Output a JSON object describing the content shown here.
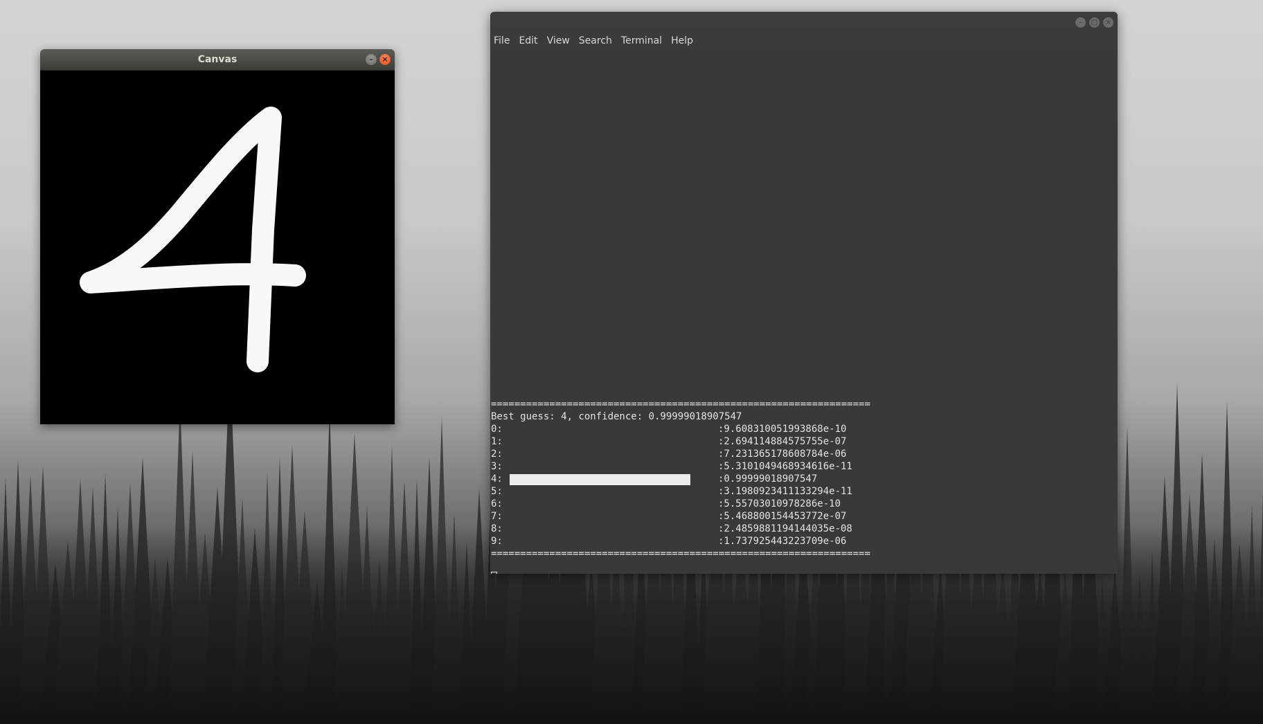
{
  "canvas_window": {
    "title": "Canvas",
    "drawn_digit": "4"
  },
  "terminal_window": {
    "menu": [
      "File",
      "Edit",
      "View",
      "Search",
      "Terminal",
      "Help"
    ],
    "separator": "=================================================================",
    "best_guess_line": "Best guess: 4, confidence: 0.99999018907547",
    "predictions": [
      {
        "digit": "0:",
        "value": ":9.608310051993868e-10",
        "probability": 0.0
      },
      {
        "digit": "1:",
        "value": ":2.694114884575755e-07",
        "probability": 0.0
      },
      {
        "digit": "2:",
        "value": ":7.231365178608784e-06",
        "probability": 0.0
      },
      {
        "digit": "3:",
        "value": ":5.3101049468934616e-11",
        "probability": 0.0
      },
      {
        "digit": "4:",
        "value": ":0.99999018907547",
        "probability": 0.99999018907547
      },
      {
        "digit": "5:",
        "value": ":3.1980923411133294e-11",
        "probability": 0.0
      },
      {
        "digit": "6:",
        "value": ":5.55703010978286e-10",
        "probability": 0.0
      },
      {
        "digit": "7:",
        "value": ":5.468800154453772e-07",
        "probability": 0.0
      },
      {
        "digit": "8:",
        "value": ":2.4859881194144035e-08",
        "probability": 0.0
      },
      {
        "digit": "9:",
        "value": ":1.737925443223709e-06",
        "probability": 0.0
      }
    ]
  }
}
